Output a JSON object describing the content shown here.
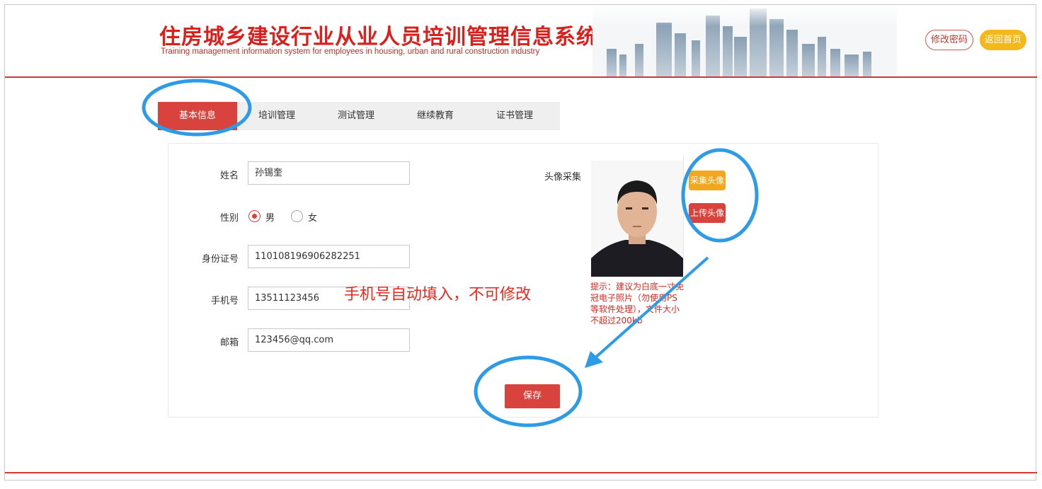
{
  "header": {
    "title_cn": "住房城乡建设行业从业人员培训管理信息系统",
    "title_en": "Training management information system for employees in housing, urban and rural construction industry",
    "change_password": "修改密码",
    "back_home": "返回首页"
  },
  "tabs": [
    {
      "label": "基本信息",
      "active": true
    },
    {
      "label": "培训管理",
      "active": false
    },
    {
      "label": "测试管理",
      "active": false
    },
    {
      "label": "继续教育",
      "active": false
    },
    {
      "label": "证书管理",
      "active": false
    }
  ],
  "form": {
    "name_label": "姓名",
    "name_value": "孙锡奎",
    "gender_label": "性别",
    "gender_options": [
      "男",
      "女"
    ],
    "gender_selected": "男",
    "id_label": "身份证号",
    "id_value": "110108196906282251",
    "phone_label": "手机号",
    "phone_value": "13511123456",
    "email_label": "邮箱",
    "email_value": "123456@qq.com",
    "avatar_label": "头像采集",
    "capture_button": "采集头像",
    "upload_button": "上传头像",
    "hint": "提示：建议为白底一寸免冠电子照片（勿使用PS等软件处理），文件大小不超过200kb",
    "save_button": "保存"
  },
  "annotation": {
    "note": "手机号自动填入，不可修改",
    "color": "#e52b21",
    "highlight_color": "#2e9be6"
  },
  "colors": {
    "brand_red": "#d8443d",
    "gold": "#f5b81c",
    "tab_bg": "#efefef"
  }
}
